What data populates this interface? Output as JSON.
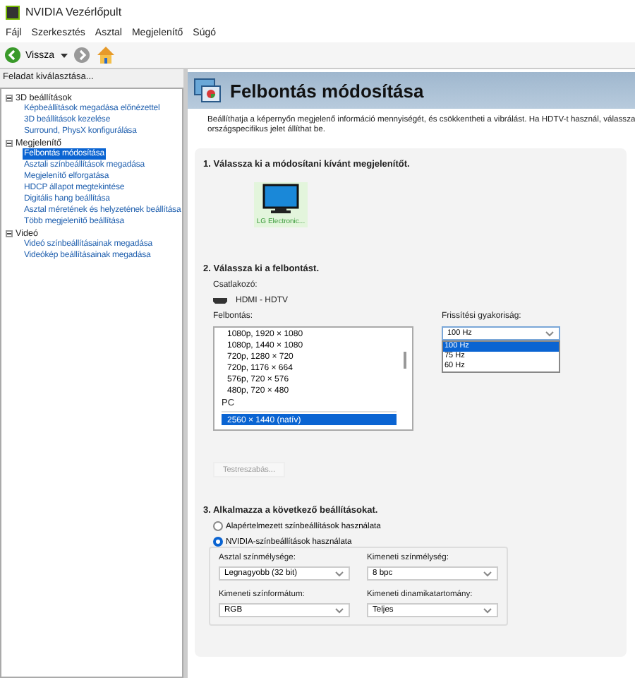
{
  "window": {
    "title": "NVIDIA Vezérlőpult"
  },
  "menu": [
    "Fájl",
    "Szerkesztés",
    "Asztal",
    "Megjelenítő",
    "Súgó"
  ],
  "toolbar": {
    "back_label": "Vissza"
  },
  "sidebar": {
    "title": "Feladat kiválasztása...",
    "tree": [
      {
        "label": "3D beállítások",
        "expanded": true,
        "children": [
          {
            "label": "Képbeállítások megadása előnézettel",
            "selected": false
          },
          {
            "label": "3D beállítások kezelése",
            "selected": false
          },
          {
            "label": "Surround, PhysX konfigurálása",
            "selected": false
          }
        ]
      },
      {
        "label": "Megjelenítő",
        "expanded": true,
        "children": [
          {
            "label": "Felbontás módosítása",
            "selected": true
          },
          {
            "label": "Asztali színbeállítások megadása",
            "selected": false
          },
          {
            "label": "Megjelenítő elforgatása",
            "selected": false
          },
          {
            "label": "HDCP állapot megtekintése",
            "selected": false
          },
          {
            "label": "Digitális hang beállítása",
            "selected": false
          },
          {
            "label": "Asztal méretének és helyzetének beállítása",
            "selected": false
          },
          {
            "label": "Több megjelenítő beállítása",
            "selected": false
          }
        ]
      },
      {
        "label": "Videó",
        "expanded": true,
        "children": [
          {
            "label": "Videó színbeállításainak megadása",
            "selected": false
          },
          {
            "label": "Videókép beállításainak megadása",
            "selected": false
          }
        ]
      }
    ]
  },
  "page": {
    "title": "Felbontás módosítása",
    "description": "Beállíthatja a képernyőn megjelenő információ mennyiségét, és csökkentheti a vibrálást. Ha HDTV-t használ, válassza",
    "description_2": "országspecifikus jelet állíthat be.",
    "step1": {
      "heading": "1. Válassza ki a módosítani kívánt megjelenítőt.",
      "displays": [
        {
          "label": "LG Electronic...",
          "selected": true
        }
      ]
    },
    "step2": {
      "heading": "2. Válassza ki a felbontást.",
      "connector_label": "Csatlakozó:",
      "connector": "HDMI - HDTV",
      "resolution_label": "Felbontás:",
      "resolutions": [
        {
          "kind": "item",
          "label": "1080p, 1920 × 1080",
          "selected": false
        },
        {
          "kind": "item",
          "label": "1080p, 1440 × 1080",
          "selected": false
        },
        {
          "kind": "item",
          "label": "720p, 1280 × 720",
          "selected": false
        },
        {
          "kind": "item",
          "label": "720p, 1176 × 664",
          "selected": false
        },
        {
          "kind": "item",
          "label": "576p, 720 × 576",
          "selected": false
        },
        {
          "kind": "item",
          "label": "480p, 720 × 480",
          "selected": false
        },
        {
          "kind": "header",
          "label": "PC"
        },
        {
          "kind": "item",
          "label": "2560 × 1440 (natív)",
          "selected": true
        }
      ],
      "refresh_label": "Frissítési gyakoriság:",
      "refresh_value": "100 Hz",
      "refresh_options": [
        {
          "label": "100 Hz",
          "selected": true
        },
        {
          "label": "75 Hz",
          "selected": false
        },
        {
          "label": "60 Hz",
          "selected": false
        }
      ],
      "customize_button": {
        "label": "Testreszabás...",
        "disabled": true
      }
    },
    "step3": {
      "heading": "3. Alkalmazza a következő beállításokat.",
      "radios": [
        {
          "label": "Alapértelmezett színbeállítások használata",
          "selected": false
        },
        {
          "label": "NVIDIA-színbeállítások használata",
          "selected": true
        }
      ],
      "fields": [
        {
          "label": "Asztal színmélysége:",
          "value": "Legnagyobb (32 bit)"
        },
        {
          "label": "Kimeneti színmélység:",
          "value": "8 bpc"
        },
        {
          "label": "Kimeneti színformátum:",
          "value": "RGB"
        },
        {
          "label": "Kimeneti dinamikatartomány:",
          "value": "Teljes"
        }
      ]
    }
  }
}
